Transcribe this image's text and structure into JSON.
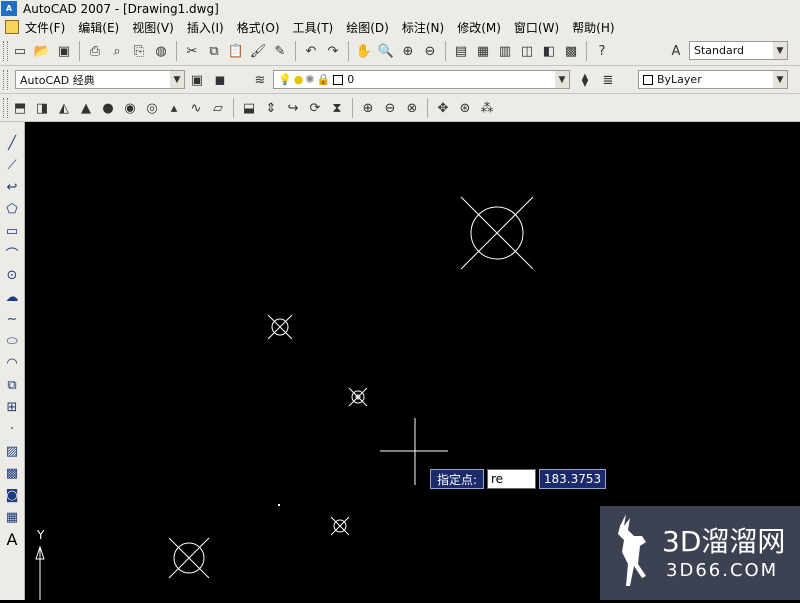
{
  "window": {
    "title": "AutoCAD 2007 - [Drawing1.dwg]",
    "app_badge": "A"
  },
  "menu": {
    "items": [
      "文件(F)",
      "编辑(E)",
      "视图(V)",
      "插入(I)",
      "格式(O)",
      "工具(T)",
      "绘图(D)",
      "标注(N)",
      "修改(M)",
      "窗口(W)",
      "帮助(H)"
    ]
  },
  "toolbar": {
    "text_style": "Standard",
    "workspace": "AutoCAD 经典",
    "layer": "0",
    "color": "ByLayer"
  },
  "canvas": {
    "ucs_axis_label": "Y",
    "dynamic_input": {
      "prompt": "指定点:",
      "value": "re",
      "coordinate": "183.3753"
    }
  },
  "watermark": {
    "title": "3D溜溜网",
    "subtitle": "3D66.COM"
  },
  "colors": {
    "background": "#000000",
    "toolbar": "#ecebe6",
    "tooltip": "#1b2a6b",
    "geometry": "#ffffff"
  }
}
